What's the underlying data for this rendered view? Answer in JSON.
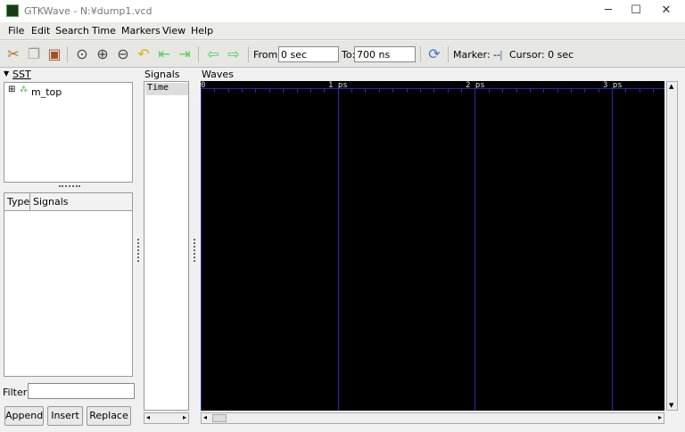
{
  "window": {
    "title": "GTKWave - N:¥dump1.vcd"
  },
  "menu": [
    "File",
    "Edit",
    "Search",
    "Time",
    "Markers",
    "View",
    "Help"
  ],
  "toolbar": {
    "from_label": "From:",
    "from_value": "0 sec",
    "to_label": "To:",
    "to_value": "700 ns",
    "marker": "Marker: --",
    "divider": "|",
    "cursor": "Cursor: 0 sec"
  },
  "sst": {
    "title": "SST",
    "tree": [
      {
        "label": "m_top"
      }
    ],
    "columns": [
      "Type",
      "Signals"
    ],
    "filter_label": "Filter:",
    "filter_value": "",
    "buttons": [
      "Append",
      "Insert",
      "Replace"
    ]
  },
  "signals": {
    "title": "Signals",
    "items": [
      "Time"
    ]
  },
  "waves": {
    "title": "Waves",
    "time_labels": [
      "0",
      "1 ps",
      "2 ps",
      "3 ps"
    ]
  },
  "colors": {
    "wave_bg": "#000000",
    "grid": "#2a2ab0"
  }
}
